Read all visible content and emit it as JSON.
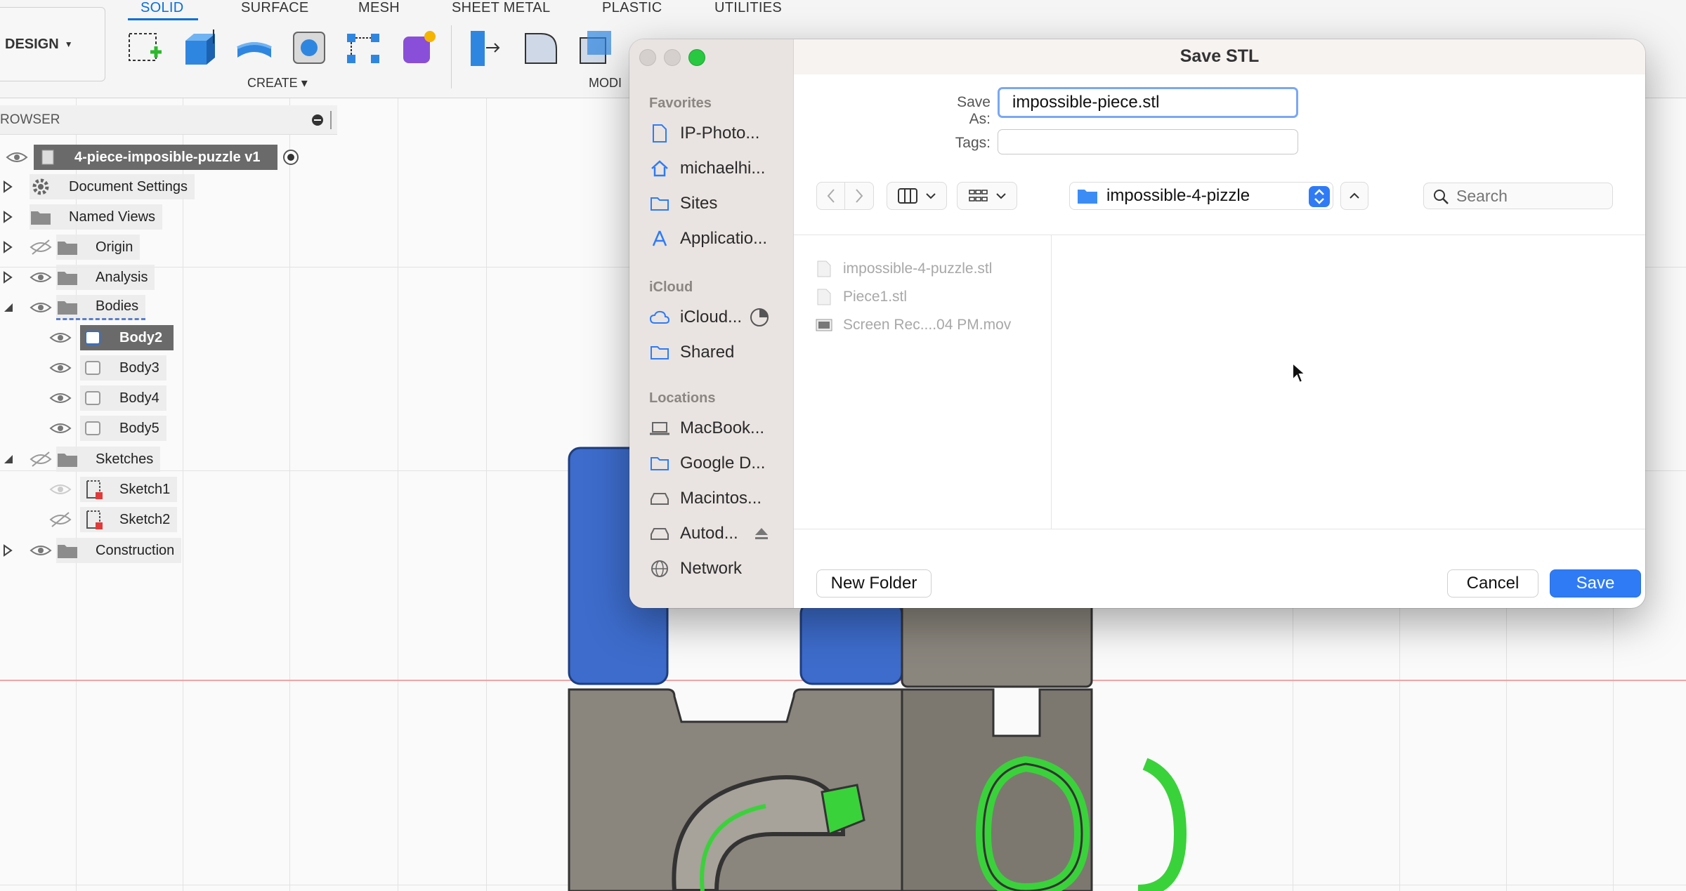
{
  "toolbar": {
    "workspace": "DESIGN",
    "tabs": [
      "SOLID",
      "SURFACE",
      "MESH",
      "SHEET METAL",
      "PLASTIC",
      "UTILITIES"
    ],
    "groups": {
      "create": "CREATE",
      "modify": "MODI"
    }
  },
  "browser": {
    "title": "ROWSER",
    "root": "4-piece-imposible-puzzle v1",
    "items": {
      "document_settings": "Document Settings",
      "named_views": "Named Views",
      "origin": "Origin",
      "analysis": "Analysis",
      "bodies": "Bodies",
      "body2": "Body2",
      "body3": "Body3",
      "body4": "Body4",
      "body5": "Body5",
      "sketches": "Sketches",
      "sketch1": "Sketch1",
      "sketch2": "Sketch2",
      "construction": "Construction"
    }
  },
  "dialog": {
    "title": "Save STL",
    "save_as_label": "Save As:",
    "save_as_value": "impossible-piece.stl",
    "tags_label": "Tags:",
    "tags_value": "",
    "location": "impossible-4-pizzle",
    "search_placeholder": "Search",
    "sidebar": {
      "favorites_header": "Favorites",
      "favorites": [
        "IP-Photo...",
        "michaelhi...",
        "Sites",
        "Applicatio..."
      ],
      "icloud_header": "iCloud",
      "icloud": [
        "iCloud...",
        "Shared"
      ],
      "locations_header": "Locations",
      "locations": [
        "MacBook...",
        "Google D...",
        "Macintos...",
        "Autod...",
        "Network"
      ]
    },
    "files": [
      "impossible-4-puzzle.stl",
      "Piece1.stl",
      "Screen Rec....04 PM.mov"
    ],
    "new_folder": "New Folder",
    "cancel": "Cancel",
    "save": "Save"
  },
  "colors": {
    "accent": "#2f7bf6",
    "fusion_blue": "#0a6fd6",
    "body_blue": "#3d6ccc",
    "puzzle_gray": "#8a857d",
    "highlight_green": "#3ad23a"
  }
}
